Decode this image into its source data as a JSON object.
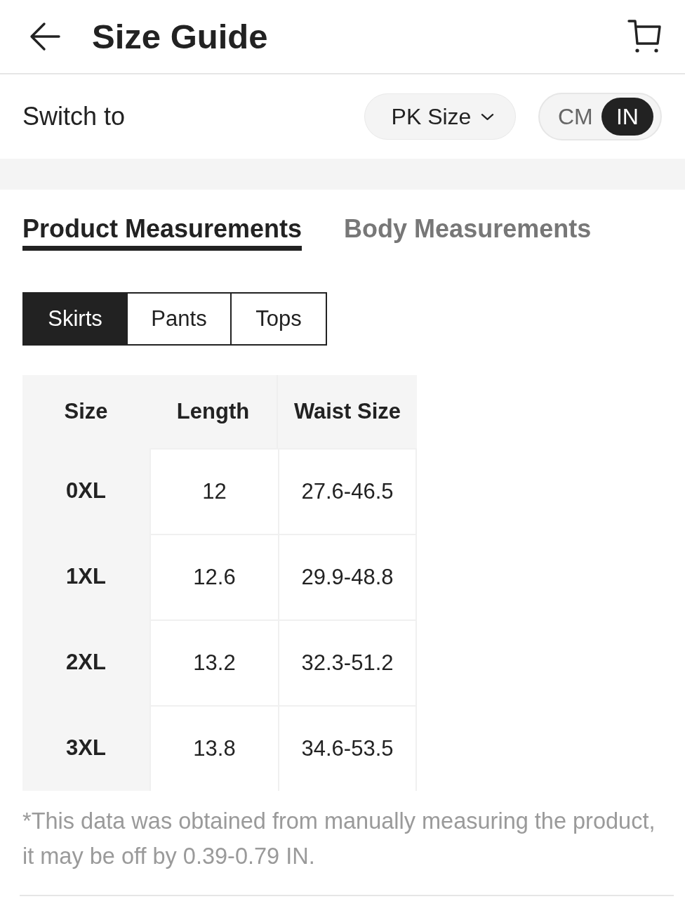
{
  "header": {
    "title": "Size Guide"
  },
  "switch_row": {
    "label": "Switch to",
    "size_system": "PK Size",
    "units": [
      {
        "label": "CM",
        "selected": false
      },
      {
        "label": "IN",
        "selected": true
      }
    ]
  },
  "measurement_tabs": [
    {
      "label": "Product Measurements",
      "selected": true
    },
    {
      "label": "Body Measurements",
      "selected": false
    }
  ],
  "categories": [
    {
      "label": "Skirts",
      "selected": true
    },
    {
      "label": "Pants",
      "selected": false
    },
    {
      "label": "Tops",
      "selected": false
    }
  ],
  "table": {
    "columns": [
      "Size",
      "Length",
      "Waist Size"
    ],
    "rows": [
      [
        "0XL",
        "12",
        "27.6-46.5"
      ],
      [
        "1XL",
        "12.6",
        "29.9-48.8"
      ],
      [
        "2XL",
        "13.2",
        "32.3-51.2"
      ],
      [
        "3XL",
        "13.8",
        "34.6-53.5"
      ]
    ]
  },
  "note": "*This data was obtained from manually measuring the product, it may be off by 0.39-0.79 IN."
}
